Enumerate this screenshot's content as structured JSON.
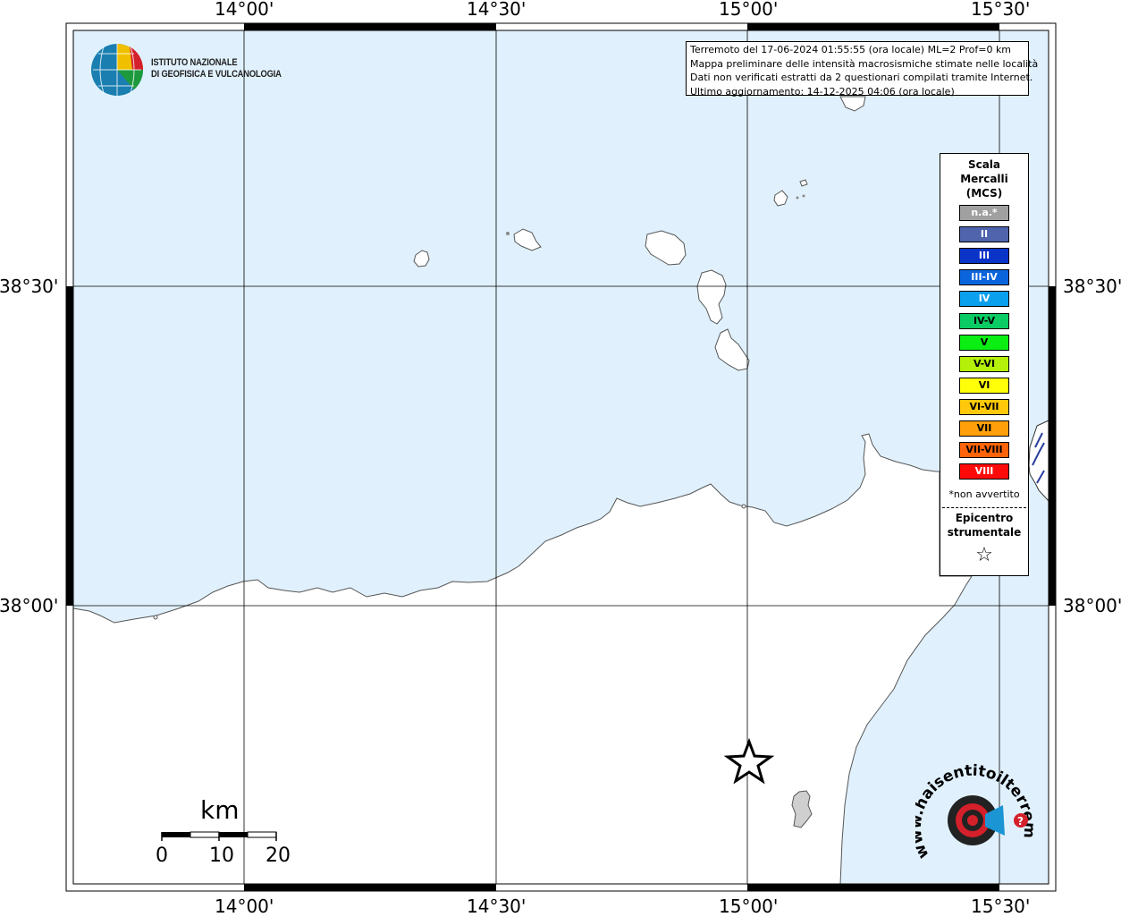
{
  "map": {
    "lon_labels": [
      "14°00'",
      "14°30'",
      "15°00'",
      "15°30'"
    ],
    "lat_labels": [
      "38°30'",
      "38°00'"
    ],
    "colors": {
      "sea": "#e0f1fd",
      "land": "#ffffff",
      "coast": "#555555",
      "grid": "#000000"
    }
  },
  "logo": {
    "line1": "ISTITUTO NAZIONALE",
    "line2": "DI GEOFISICA E VULCANOLOGIA",
    "icon": "ingv-globe-icon"
  },
  "info": {
    "line1": "Terremoto del 17-06-2024 01:55:55 (ora locale) ML=2 Prof=0 km",
    "line2": "Mappa preliminare delle intensità macrosismiche stimate nelle località",
    "line3": "Dati non verificati estratti da 2 questionari compilati tramite Internet.",
    "line4": "Ultimo aggiornamento: 14-12-2025 04:06 (ora locale)"
  },
  "legend": {
    "title1": "Scala",
    "title2": "Mercalli",
    "title3": "(MCS)",
    "items": [
      {
        "label": "n.a.*",
        "color": "#a0a0a0",
        "text": "#ffffff"
      },
      {
        "label": "II",
        "color": "#4f64ad",
        "text": "#ffffff"
      },
      {
        "label": "III",
        "color": "#0a34c8",
        "text": "#ffffff"
      },
      {
        "label": "III-IV",
        "color": "#0a64dc",
        "text": "#ffffff"
      },
      {
        "label": "IV",
        "color": "#0aa0ee",
        "text": "#ffffff"
      },
      {
        "label": "IV-V",
        "color": "#0acc64",
        "text": "#000000"
      },
      {
        "label": "V",
        "color": "#0aee14",
        "text": "#000000"
      },
      {
        "label": "V-VI",
        "color": "#b4f00a",
        "text": "#000000"
      },
      {
        "label": "VI",
        "color": "#ffff0a",
        "text": "#000000"
      },
      {
        "label": "VI-VII",
        "color": "#ffc80a",
        "text": "#000000"
      },
      {
        "label": "VII",
        "color": "#ffa00a",
        "text": "#000000"
      },
      {
        "label": "VII-VIII",
        "color": "#ff640a",
        "text": "#000000"
      },
      {
        "label": "VIII",
        "color": "#ff0a0a",
        "text": "#ffffff"
      }
    ],
    "note": "*non avvertito",
    "epicenter1": "Epicentro",
    "epicenter2": "strumentale",
    "epicenter_icon": "star-outline-icon"
  },
  "scalebar": {
    "unit": "km",
    "labels": [
      "0",
      "10",
      "20"
    ]
  },
  "epicenter": {
    "icon": "star-outline-icon"
  },
  "badge": {
    "text": "www.haisentitoilterremoto.it",
    "icon": "target-megaphone-icon"
  }
}
